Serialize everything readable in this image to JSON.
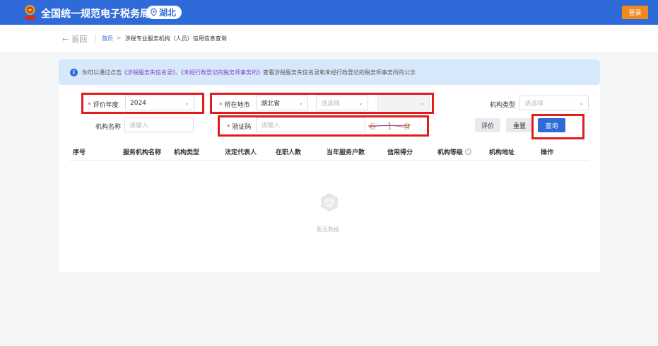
{
  "header": {
    "site_title": "全国统一规范电子税务局",
    "region": "湖北",
    "login_label": "登录"
  },
  "nav": {
    "back_label": "返回",
    "breadcrumb_home": "首页",
    "breadcrumb_separator": ">",
    "breadcrumb_current": "涉税专业服务机构（人员）信用信息查询"
  },
  "notice": {
    "prefix": "你可以通过点击",
    "link1": "《涉税服务失信名录》",
    "joiner": "、",
    "link2": "《未经行政登记的税务师事务所》",
    "suffix": "查看涉税服务失信名录和未经行政登记的税务师事务所的公示"
  },
  "form": {
    "required_mark": "*",
    "year_label": "评价年度",
    "year_value": "2024",
    "location_label": "所在地市",
    "province_value": "湖北省",
    "city_placeholder": "请选择",
    "district_value": "",
    "org_type_label": "机构类型",
    "org_type_placeholder": "请选择",
    "org_name_label": "机构名称",
    "org_name_placeholder": "请输入",
    "captcha_label": "验证码",
    "captcha_placeholder": "请输入",
    "captcha_text": "6 1 9 7"
  },
  "buttons": {
    "evaluate": "评价",
    "reset": "重置",
    "search": "查询"
  },
  "table": {
    "columns": [
      "序号",
      "服务机构名称",
      "机构类型",
      "法定代表人",
      "在职人数",
      "当年服务户数",
      "信用得分",
      "机构等级",
      "机构地址",
      "操作"
    ],
    "empty_text": "暂无数据"
  },
  "colors": {
    "primary": "#2f6bd8",
    "login": "#f08a1c",
    "highlight": "#e01c1c",
    "link": "#7a3fbf"
  }
}
